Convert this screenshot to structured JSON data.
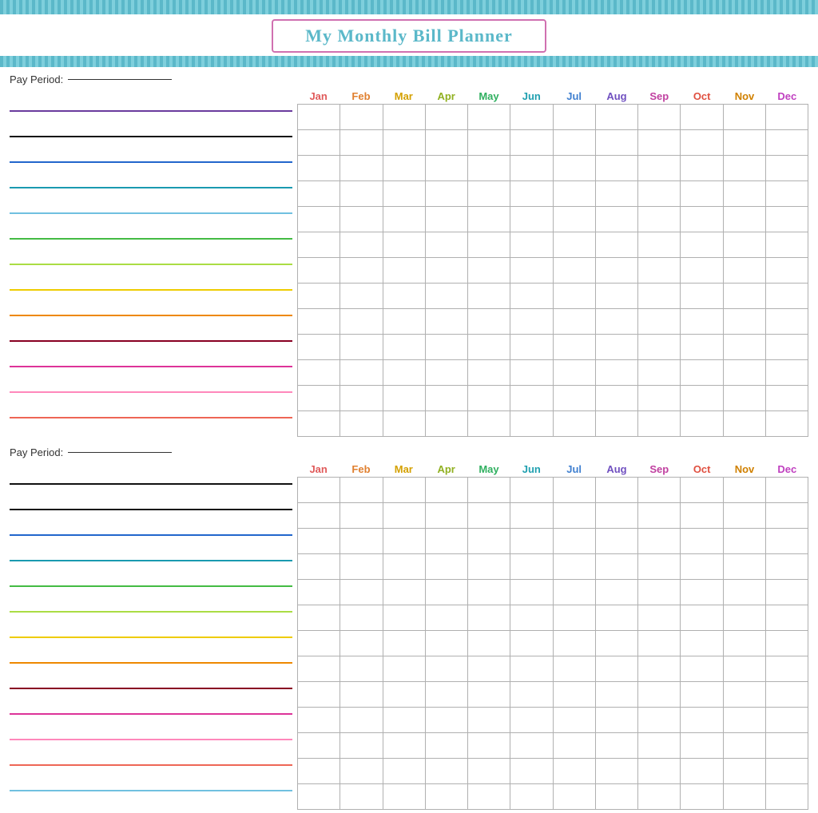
{
  "header": {
    "title": "My Monthly Bill Planner"
  },
  "months": [
    "Jan",
    "Feb",
    "Mar",
    "Apr",
    "May",
    "Jun",
    "Jul",
    "Aug",
    "Sep",
    "Oct",
    "Nov",
    "Dec"
  ],
  "month_classes": [
    "jan",
    "feb",
    "mar",
    "apr",
    "may",
    "jun",
    "jul",
    "aug",
    "sep",
    "oct",
    "nov",
    "dec"
  ],
  "pay_period_label": "Pay Period:",
  "sections": [
    {
      "rows": 13,
      "line_colors": [
        "lc-purple",
        "lc-black",
        "lc-blue",
        "lc-teal",
        "lc-ltblue",
        "lc-green",
        "lc-ltgreen",
        "lc-yellow",
        "lc-orange",
        "lc-darkred",
        "lc-pink",
        "lc-ltpink",
        "lc-salmon"
      ]
    },
    {
      "rows": 13,
      "line_colors": [
        "lc-black",
        "lc-black",
        "lc-blue",
        "lc-teal",
        "lc-green",
        "lc-ltgreen",
        "lc-yellow",
        "lc-orange",
        "lc-darkred",
        "lc-pink",
        "lc-ltpink",
        "lc-salmon",
        "lc-ltblue"
      ]
    }
  ]
}
